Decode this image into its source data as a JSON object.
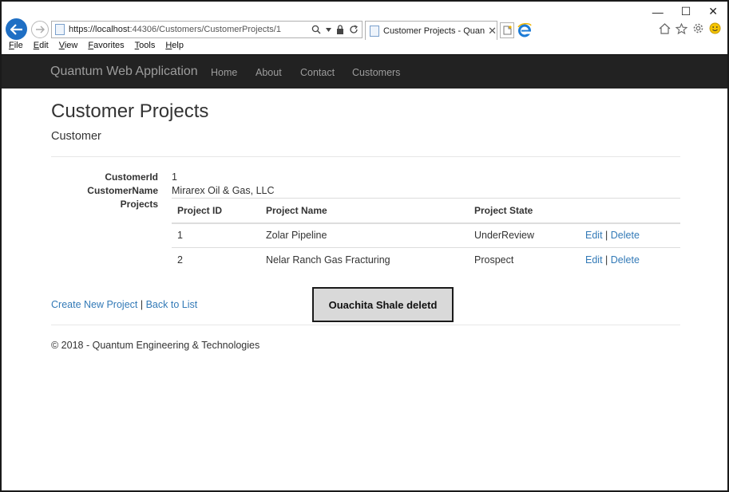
{
  "browser": {
    "url_host": "https://localhost",
    "url_path": ":44306/Customers/CustomerProjects/1",
    "tab_title": "Customer Projects - Quant...",
    "menu": [
      "File",
      "Edit",
      "View",
      "Favorites",
      "Tools",
      "Help"
    ]
  },
  "navbar": {
    "brand": "Quantum Web Application",
    "links": [
      "Home",
      "About",
      "Contact",
      "Customers"
    ]
  },
  "page": {
    "title": "Customer Projects",
    "subtitle": "Customer"
  },
  "details": {
    "customer_id_label": "CustomerId",
    "customer_id": "1",
    "customer_name_label": "CustomerName",
    "customer_name": "Mirarex Oil & Gas, LLC",
    "projects_label": "Projects"
  },
  "projects": {
    "headers": [
      "Project ID",
      "Project Name",
      "Project State"
    ],
    "rows": [
      {
        "id": "1",
        "name": "Zolar Pipeline",
        "state": "UnderReview",
        "edit": "Edit",
        "sep": "|",
        "delete": "Delete"
      },
      {
        "id": "2",
        "name": "Nelar Ranch Gas Fracturing",
        "state": "Prospect",
        "edit": "Edit",
        "sep": "|",
        "delete": "Delete"
      }
    ]
  },
  "actions": {
    "create": "Create New Project",
    "sep": "|",
    "back": "Back to List"
  },
  "toast": "Ouachita Shale deletd",
  "footer": "© 2018 - Quantum Engineering & Technologies",
  "colors": {
    "navbar_bg": "#222222",
    "link": "#337ab7",
    "back_button": "#1f6fc4"
  }
}
